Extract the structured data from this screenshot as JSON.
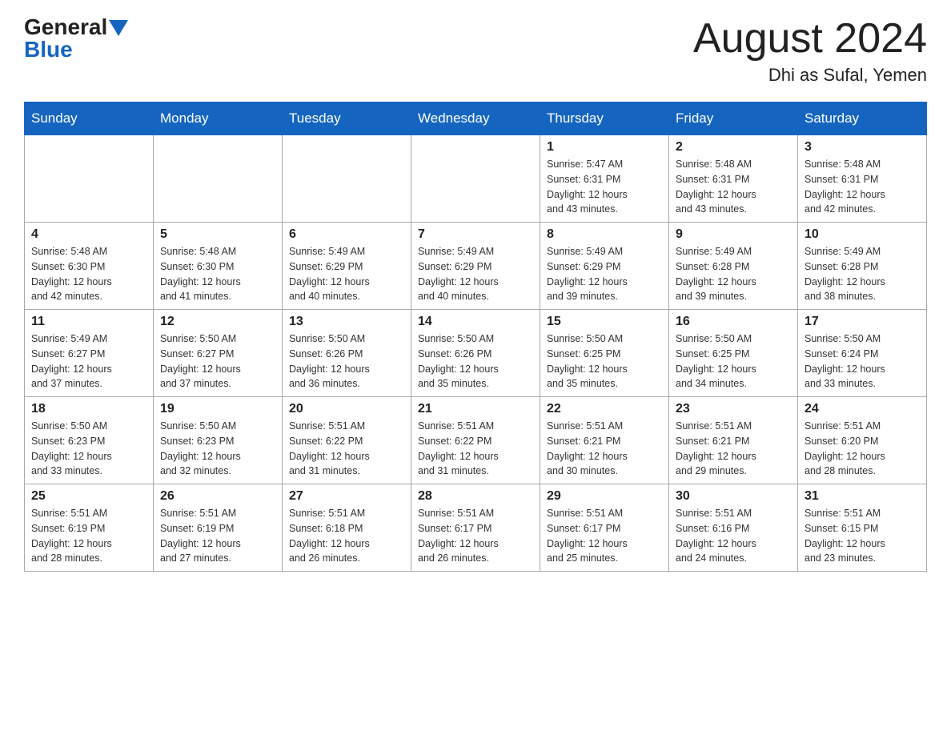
{
  "header": {
    "logo_general": "General",
    "logo_blue": "Blue",
    "month_title": "August 2024",
    "location": "Dhi as Sufal, Yemen"
  },
  "weekdays": [
    "Sunday",
    "Monday",
    "Tuesday",
    "Wednesday",
    "Thursday",
    "Friday",
    "Saturday"
  ],
  "weeks": [
    [
      {
        "day": "",
        "info": ""
      },
      {
        "day": "",
        "info": ""
      },
      {
        "day": "",
        "info": ""
      },
      {
        "day": "",
        "info": ""
      },
      {
        "day": "1",
        "info": "Sunrise: 5:47 AM\nSunset: 6:31 PM\nDaylight: 12 hours\nand 43 minutes."
      },
      {
        "day": "2",
        "info": "Sunrise: 5:48 AM\nSunset: 6:31 PM\nDaylight: 12 hours\nand 43 minutes."
      },
      {
        "day": "3",
        "info": "Sunrise: 5:48 AM\nSunset: 6:31 PM\nDaylight: 12 hours\nand 42 minutes."
      }
    ],
    [
      {
        "day": "4",
        "info": "Sunrise: 5:48 AM\nSunset: 6:30 PM\nDaylight: 12 hours\nand 42 minutes."
      },
      {
        "day": "5",
        "info": "Sunrise: 5:48 AM\nSunset: 6:30 PM\nDaylight: 12 hours\nand 41 minutes."
      },
      {
        "day": "6",
        "info": "Sunrise: 5:49 AM\nSunset: 6:29 PM\nDaylight: 12 hours\nand 40 minutes."
      },
      {
        "day": "7",
        "info": "Sunrise: 5:49 AM\nSunset: 6:29 PM\nDaylight: 12 hours\nand 40 minutes."
      },
      {
        "day": "8",
        "info": "Sunrise: 5:49 AM\nSunset: 6:29 PM\nDaylight: 12 hours\nand 39 minutes."
      },
      {
        "day": "9",
        "info": "Sunrise: 5:49 AM\nSunset: 6:28 PM\nDaylight: 12 hours\nand 39 minutes."
      },
      {
        "day": "10",
        "info": "Sunrise: 5:49 AM\nSunset: 6:28 PM\nDaylight: 12 hours\nand 38 minutes."
      }
    ],
    [
      {
        "day": "11",
        "info": "Sunrise: 5:49 AM\nSunset: 6:27 PM\nDaylight: 12 hours\nand 37 minutes."
      },
      {
        "day": "12",
        "info": "Sunrise: 5:50 AM\nSunset: 6:27 PM\nDaylight: 12 hours\nand 37 minutes."
      },
      {
        "day": "13",
        "info": "Sunrise: 5:50 AM\nSunset: 6:26 PM\nDaylight: 12 hours\nand 36 minutes."
      },
      {
        "day": "14",
        "info": "Sunrise: 5:50 AM\nSunset: 6:26 PM\nDaylight: 12 hours\nand 35 minutes."
      },
      {
        "day": "15",
        "info": "Sunrise: 5:50 AM\nSunset: 6:25 PM\nDaylight: 12 hours\nand 35 minutes."
      },
      {
        "day": "16",
        "info": "Sunrise: 5:50 AM\nSunset: 6:25 PM\nDaylight: 12 hours\nand 34 minutes."
      },
      {
        "day": "17",
        "info": "Sunrise: 5:50 AM\nSunset: 6:24 PM\nDaylight: 12 hours\nand 33 minutes."
      }
    ],
    [
      {
        "day": "18",
        "info": "Sunrise: 5:50 AM\nSunset: 6:23 PM\nDaylight: 12 hours\nand 33 minutes."
      },
      {
        "day": "19",
        "info": "Sunrise: 5:50 AM\nSunset: 6:23 PM\nDaylight: 12 hours\nand 32 minutes."
      },
      {
        "day": "20",
        "info": "Sunrise: 5:51 AM\nSunset: 6:22 PM\nDaylight: 12 hours\nand 31 minutes."
      },
      {
        "day": "21",
        "info": "Sunrise: 5:51 AM\nSunset: 6:22 PM\nDaylight: 12 hours\nand 31 minutes."
      },
      {
        "day": "22",
        "info": "Sunrise: 5:51 AM\nSunset: 6:21 PM\nDaylight: 12 hours\nand 30 minutes."
      },
      {
        "day": "23",
        "info": "Sunrise: 5:51 AM\nSunset: 6:21 PM\nDaylight: 12 hours\nand 29 minutes."
      },
      {
        "day": "24",
        "info": "Sunrise: 5:51 AM\nSunset: 6:20 PM\nDaylight: 12 hours\nand 28 minutes."
      }
    ],
    [
      {
        "day": "25",
        "info": "Sunrise: 5:51 AM\nSunset: 6:19 PM\nDaylight: 12 hours\nand 28 minutes."
      },
      {
        "day": "26",
        "info": "Sunrise: 5:51 AM\nSunset: 6:19 PM\nDaylight: 12 hours\nand 27 minutes."
      },
      {
        "day": "27",
        "info": "Sunrise: 5:51 AM\nSunset: 6:18 PM\nDaylight: 12 hours\nand 26 minutes."
      },
      {
        "day": "28",
        "info": "Sunrise: 5:51 AM\nSunset: 6:17 PM\nDaylight: 12 hours\nand 26 minutes."
      },
      {
        "day": "29",
        "info": "Sunrise: 5:51 AM\nSunset: 6:17 PM\nDaylight: 12 hours\nand 25 minutes."
      },
      {
        "day": "30",
        "info": "Sunrise: 5:51 AM\nSunset: 6:16 PM\nDaylight: 12 hours\nand 24 minutes."
      },
      {
        "day": "31",
        "info": "Sunrise: 5:51 AM\nSunset: 6:15 PM\nDaylight: 12 hours\nand 23 minutes."
      }
    ]
  ]
}
